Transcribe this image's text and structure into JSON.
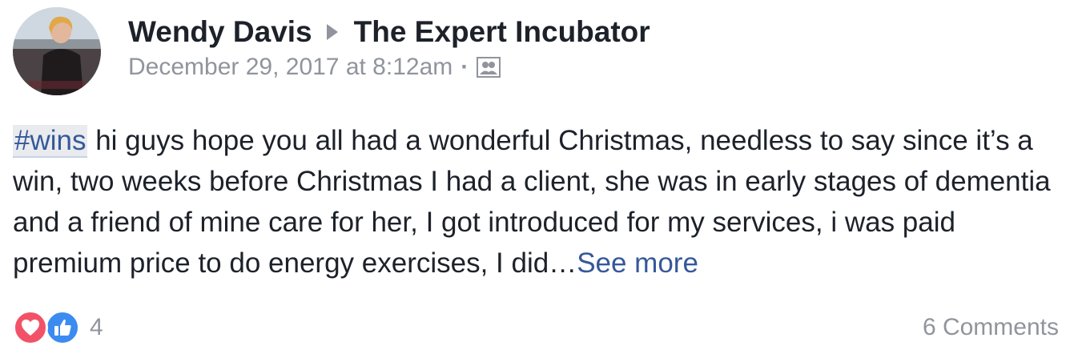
{
  "post": {
    "author": "Wendy Davis",
    "group": "The Expert Incubator",
    "timestamp": "December 29, 2017 at 8:12am",
    "separator": "·",
    "audience_icon": "group-members-icon",
    "hashtag": "#wins",
    "body": " hi guys hope you all had a wonderful Christmas, needless to say since it’s a win, two weeks before Christmas I had a client, she was in early stages of dementia and a friend of mine care for her, I got introduced for my services, i was paid premium price to do energy exercises, I did…",
    "see_more": "See more"
  },
  "footer": {
    "reactions": [
      "love-reaction-icon",
      "like-reaction-icon"
    ],
    "reaction_count": "4",
    "comments": "6 Comments"
  },
  "colors": {
    "link": "#365899",
    "meta": "#90949c",
    "love": "#f25268",
    "like": "#3b8bf0"
  }
}
